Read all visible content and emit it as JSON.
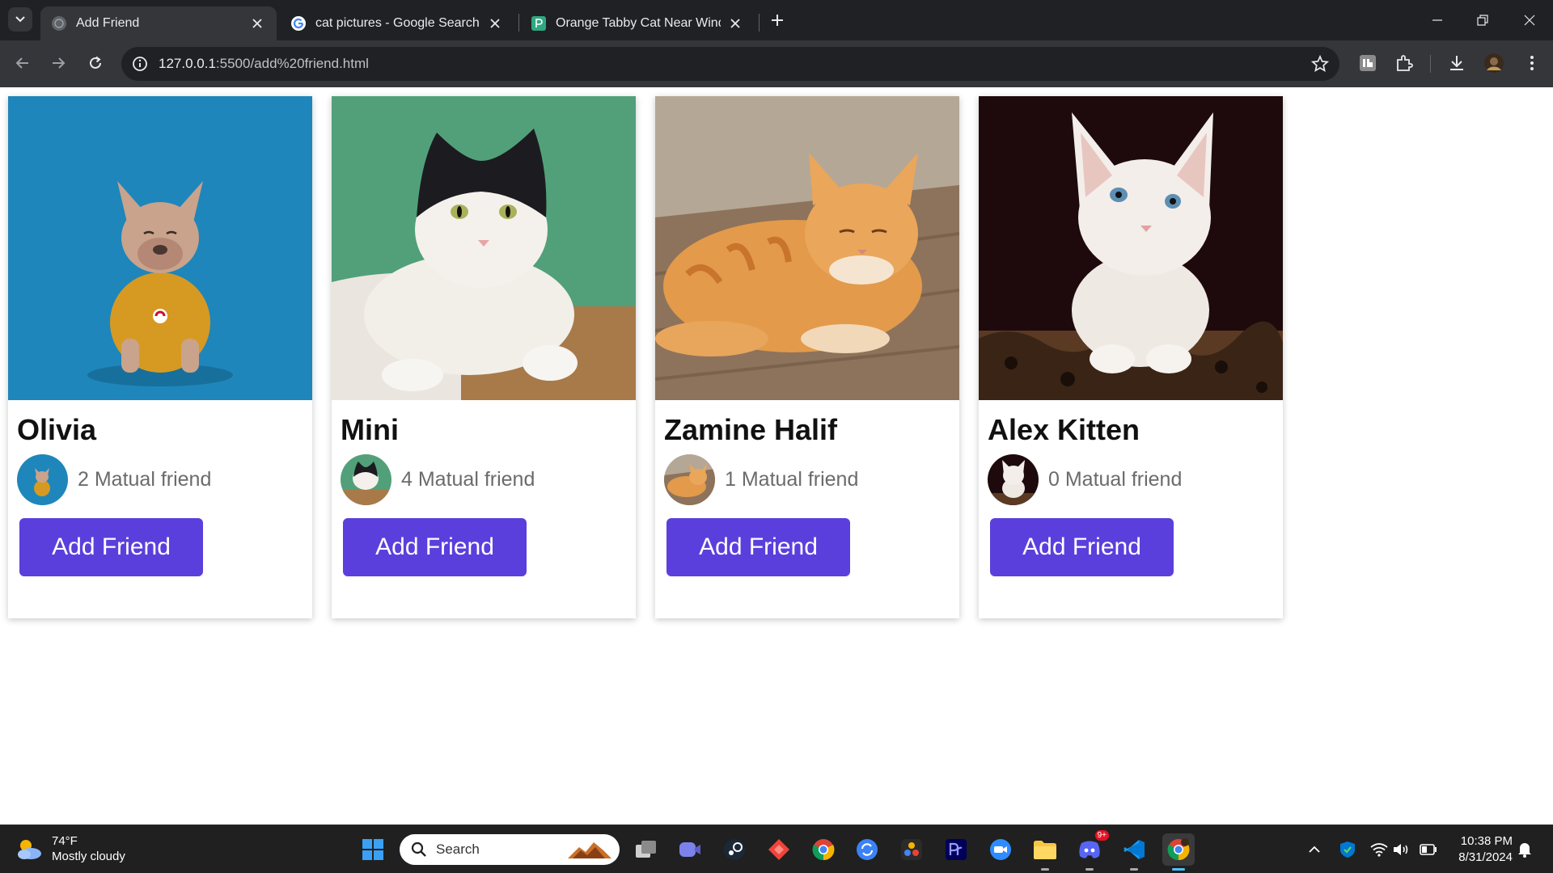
{
  "browser": {
    "tabs": [
      {
        "title": "Add Friend",
        "active": true
      },
      {
        "title": "cat pictures - Google Search",
        "active": false
      },
      {
        "title": "Orange Tabby Cat Near Window",
        "active": false
      }
    ],
    "url_host": "127.0.0.1",
    "url_path": ":5500/add%20friend.html"
  },
  "cards": [
    {
      "name": "Olivia",
      "mutual": "2 Matual friend",
      "button": "Add Friend",
      "photo": "french-bulldog-yellow-sweater-blue-background"
    },
    {
      "name": "Mini",
      "mutual": "4 Matual friend",
      "button": "Add Friend",
      "photo": "black-white-cat-green-background"
    },
    {
      "name": "Zamine Halif",
      "mutual": "1 Matual friend",
      "button": "Add Friend",
      "photo": "orange-tabby-cat-lying-on-floor"
    },
    {
      "name": "Alex Kitten",
      "mutual": "0 Matual friend",
      "button": "Add Friend",
      "photo": "white-kitten-dark-background"
    }
  ],
  "taskbar": {
    "weather_temp": "74°F",
    "weather_desc": "Mostly cloudy",
    "search_placeholder": "Search",
    "discord_badge": "9+",
    "time": "10:38 PM",
    "date": "8/31/2024"
  },
  "colors": {
    "button": "#5b3fdc",
    "tab_strip": "#202124",
    "toolbar": "#35363a",
    "taskbar": "#202020"
  }
}
